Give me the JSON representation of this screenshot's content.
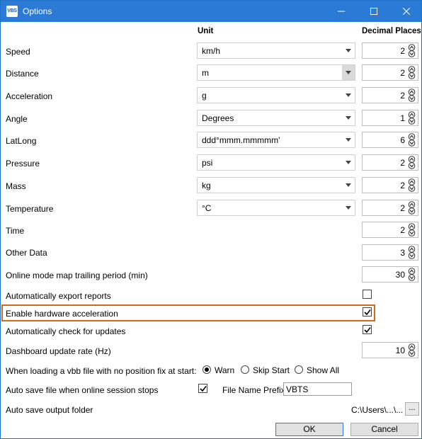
{
  "window": {
    "title": "Options",
    "app_icon_text": "VBS"
  },
  "headers": {
    "unit": "Unit",
    "decimal_places": "Decimal Places"
  },
  "rows": [
    {
      "label": "Speed",
      "unit": "km/h",
      "decimals": "2"
    },
    {
      "label": "Distance",
      "unit": "m",
      "decimals": "2"
    },
    {
      "label": "Acceleration",
      "unit": "g",
      "decimals": "2"
    },
    {
      "label": "Angle",
      "unit": "Degrees",
      "decimals": "1"
    },
    {
      "label": "LatLong",
      "unit": "ddd°mmm.mmmmm'",
      "decimals": "6"
    },
    {
      "label": "Pressure",
      "unit": "psi",
      "decimals": "2"
    },
    {
      "label": "Mass",
      "unit": "kg",
      "decimals": "2"
    },
    {
      "label": "Temperature",
      "unit": "°C",
      "decimals": "2"
    },
    {
      "label": "Time",
      "decimals": "2"
    },
    {
      "label": "Other Data",
      "decimals": "3"
    }
  ],
  "settings": {
    "map_trailing": {
      "label": "Online mode map trailing period (min)",
      "value": "30"
    },
    "auto_export": {
      "label": "Automatically export reports",
      "checked": false
    },
    "hw_accel": {
      "label": "Enable hardware acceleration",
      "checked": true
    },
    "auto_update": {
      "label": "Automatically check for updates",
      "checked": true
    },
    "dashboard_rate": {
      "label": "Dashboard update rate (Hz)",
      "value": "10"
    },
    "no_fix": {
      "label": "When loading a vbb file with no position fix at start:",
      "options": [
        "Warn",
        "Skip Start",
        "Show All"
      ],
      "selected": "Warn"
    },
    "auto_save": {
      "label": "Auto save file when online session stops",
      "checked": true,
      "prefix_label": "File Name Prefix",
      "prefix_value": "VBTS"
    },
    "output_folder": {
      "label": "Auto save output folder",
      "path": "C:\\Users\\...\\...",
      "browse_label": "..."
    }
  },
  "buttons": {
    "ok": "OK",
    "cancel": "Cancel"
  },
  "colors": {
    "titlebar": "#2b7bd6",
    "highlight": "#d4681c"
  }
}
